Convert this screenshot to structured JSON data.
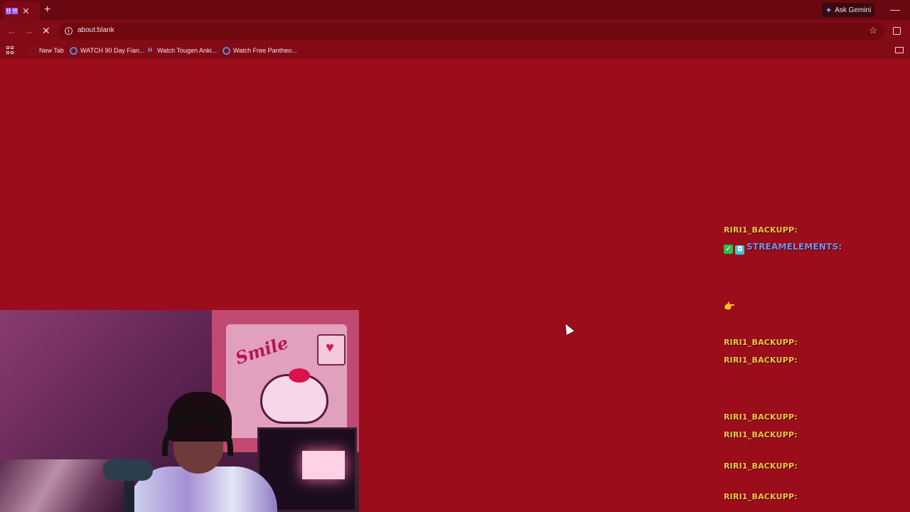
{
  "browser": {
    "tab_close": "✕",
    "new_tab": "+",
    "gemini_label": "Ask Gemini",
    "minimize": "—",
    "back": "←",
    "forward": "→",
    "reload": "✕",
    "url": "about:blank",
    "star": "☆",
    "bookmarks": [
      {
        "label": "New Tab",
        "icon": "blank-page-icon"
      },
      {
        "label": "WATCH 90 Day Fian...",
        "icon": "globe-icon"
      },
      {
        "label": "Watch Tougen Anki...",
        "icon": "h-logo-icon"
      },
      {
        "label": "Watch Free Pantheo...",
        "icon": "globe-icon"
      }
    ]
  },
  "webcam": {
    "poster_text": "Smile"
  },
  "chat": {
    "messages": [
      {
        "user": "RIRI1_BACKUPP:",
        "text": "",
        "type": "user"
      },
      {
        "user": "STREAMELEMENTS:",
        "text": "",
        "type": "bot"
      },
      {
        "user": "RIRI1_BACKUPP:",
        "text": "",
        "type": "user"
      },
      {
        "user": "RIRI1_BACKUPP:",
        "text": "",
        "type": "user"
      },
      {
        "user": "RIRI1_BACKUPP:",
        "text": "",
        "type": "user"
      },
      {
        "user": "RIRI1_BACKUPP:",
        "text": "",
        "type": "user"
      },
      {
        "user": "RIRI1_BACKUPP:",
        "text": "",
        "type": "user"
      },
      {
        "user": "RIRI1_BACKUPP:",
        "text": "",
        "type": "user"
      }
    ],
    "hand_emoji": "👉"
  },
  "colors": {
    "page_background": "#9b0d1b",
    "chat_username": "#f2c53d",
    "bot_username": "#7d8ee8",
    "chat_text": "#c81024"
  }
}
